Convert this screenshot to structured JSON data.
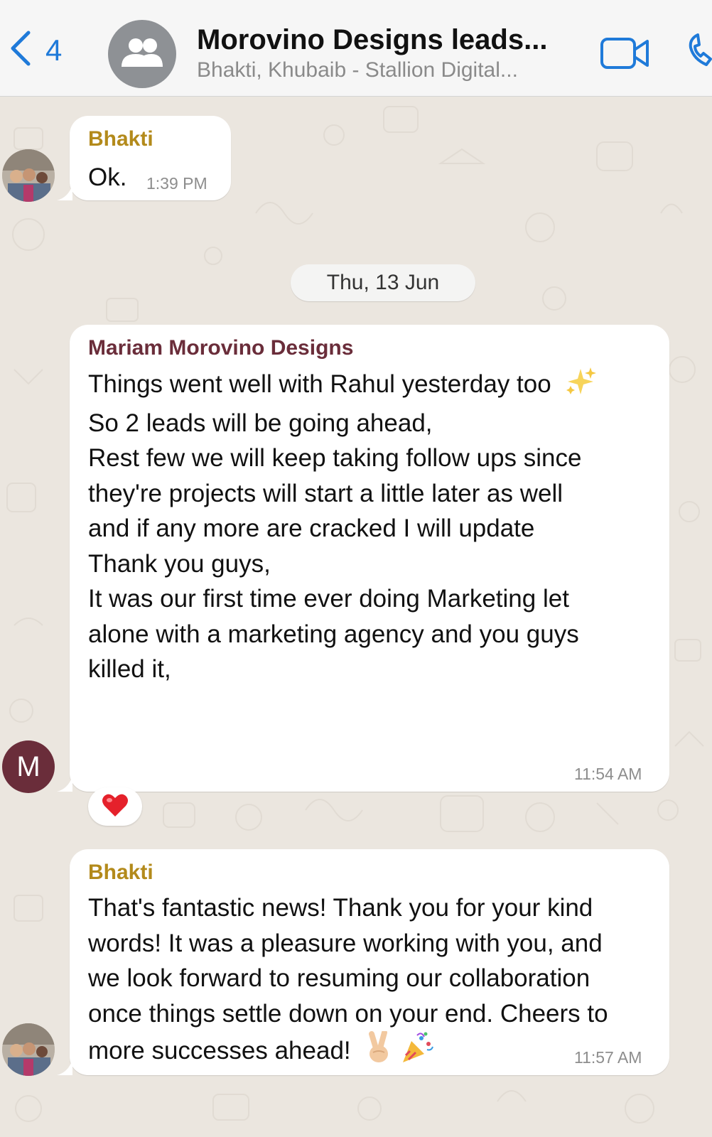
{
  "header": {
    "back_count": "4",
    "title": "Morovino Designs leads...",
    "subtitle": "Bhakti, Khubaib - Stallion Digital..."
  },
  "colors": {
    "accent_blue": "#1f7ad9",
    "sender_bhakti": "#b38a1b",
    "sender_mariam": "#6a2d3a",
    "chat_background": "#ebe6df"
  },
  "date_separator": "Thu, 13 Jun",
  "messages": [
    {
      "sender": "Bhakti",
      "lines": [
        "Ok."
      ],
      "time": "1:39 PM"
    },
    {
      "sender": "Mariam Morovino Designs",
      "avatar_letter": "M",
      "lines": [
        "Things went well with Rahul yesterday too",
        "So 2 leads will be going ahead,",
        "Rest few we will keep taking follow ups since",
        "they're projects will start a little later as well",
        "and if any more are cracked I will update",
        "Thank you guys,",
        "It was our first time ever doing Marketing let",
        "alone with a marketing agency and you guys",
        "killed it,"
      ],
      "emoji_after_line1": "sparkles-icon",
      "time": "11:54 AM",
      "reaction": "heart-icon"
    },
    {
      "sender": "Bhakti",
      "lines": [
        "That's fantastic news! Thank you for your kind",
        "words! It was a pleasure working with you, and",
        "we look forward to resuming our collaboration",
        "once things settle down on your end. Cheers to",
        "more successes ahead!"
      ],
      "emoji_after_last_line": [
        "victory-hand-icon",
        "party-popper-icon"
      ],
      "time": "11:57 AM"
    }
  ]
}
